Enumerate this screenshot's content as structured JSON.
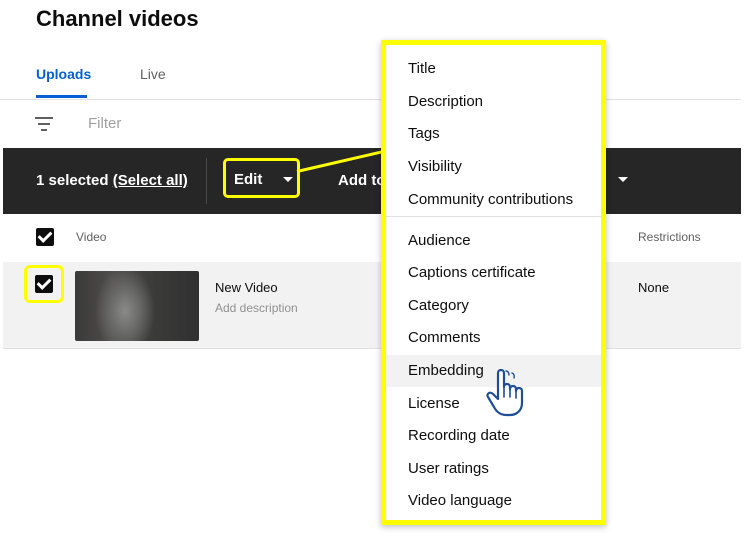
{
  "page": {
    "title": "Channel videos"
  },
  "tabs": [
    {
      "label": "Uploads",
      "active": true
    },
    {
      "label": "Live",
      "active": false
    }
  ],
  "filter": {
    "placeholder": "Filter",
    "icon": "filter-icon"
  },
  "action_bar": {
    "selected_text": "1 selected",
    "select_all": "(Select all)",
    "edit_label": "Edit",
    "add_to_label": "Add to"
  },
  "table": {
    "headers": {
      "video": "Video",
      "restrictions": "Restrictions"
    },
    "rows": [
      {
        "title": "New Video",
        "description": "Add description",
        "restrictions": "None",
        "checked": true
      }
    ]
  },
  "edit_menu": {
    "items": [
      "Title",
      "Description",
      "Tags",
      "Visibility",
      "Community contributions",
      "Audience",
      "Captions certificate",
      "Category",
      "Comments",
      "Embedding",
      "License",
      "Recording date",
      "User ratings",
      "Video language"
    ],
    "hovered": "Embedding"
  },
  "colors": {
    "accent": "#065fd4",
    "highlight": "#ffff00",
    "action_bar_bg": "#262626",
    "cursor_outline": "#1f4e99"
  }
}
